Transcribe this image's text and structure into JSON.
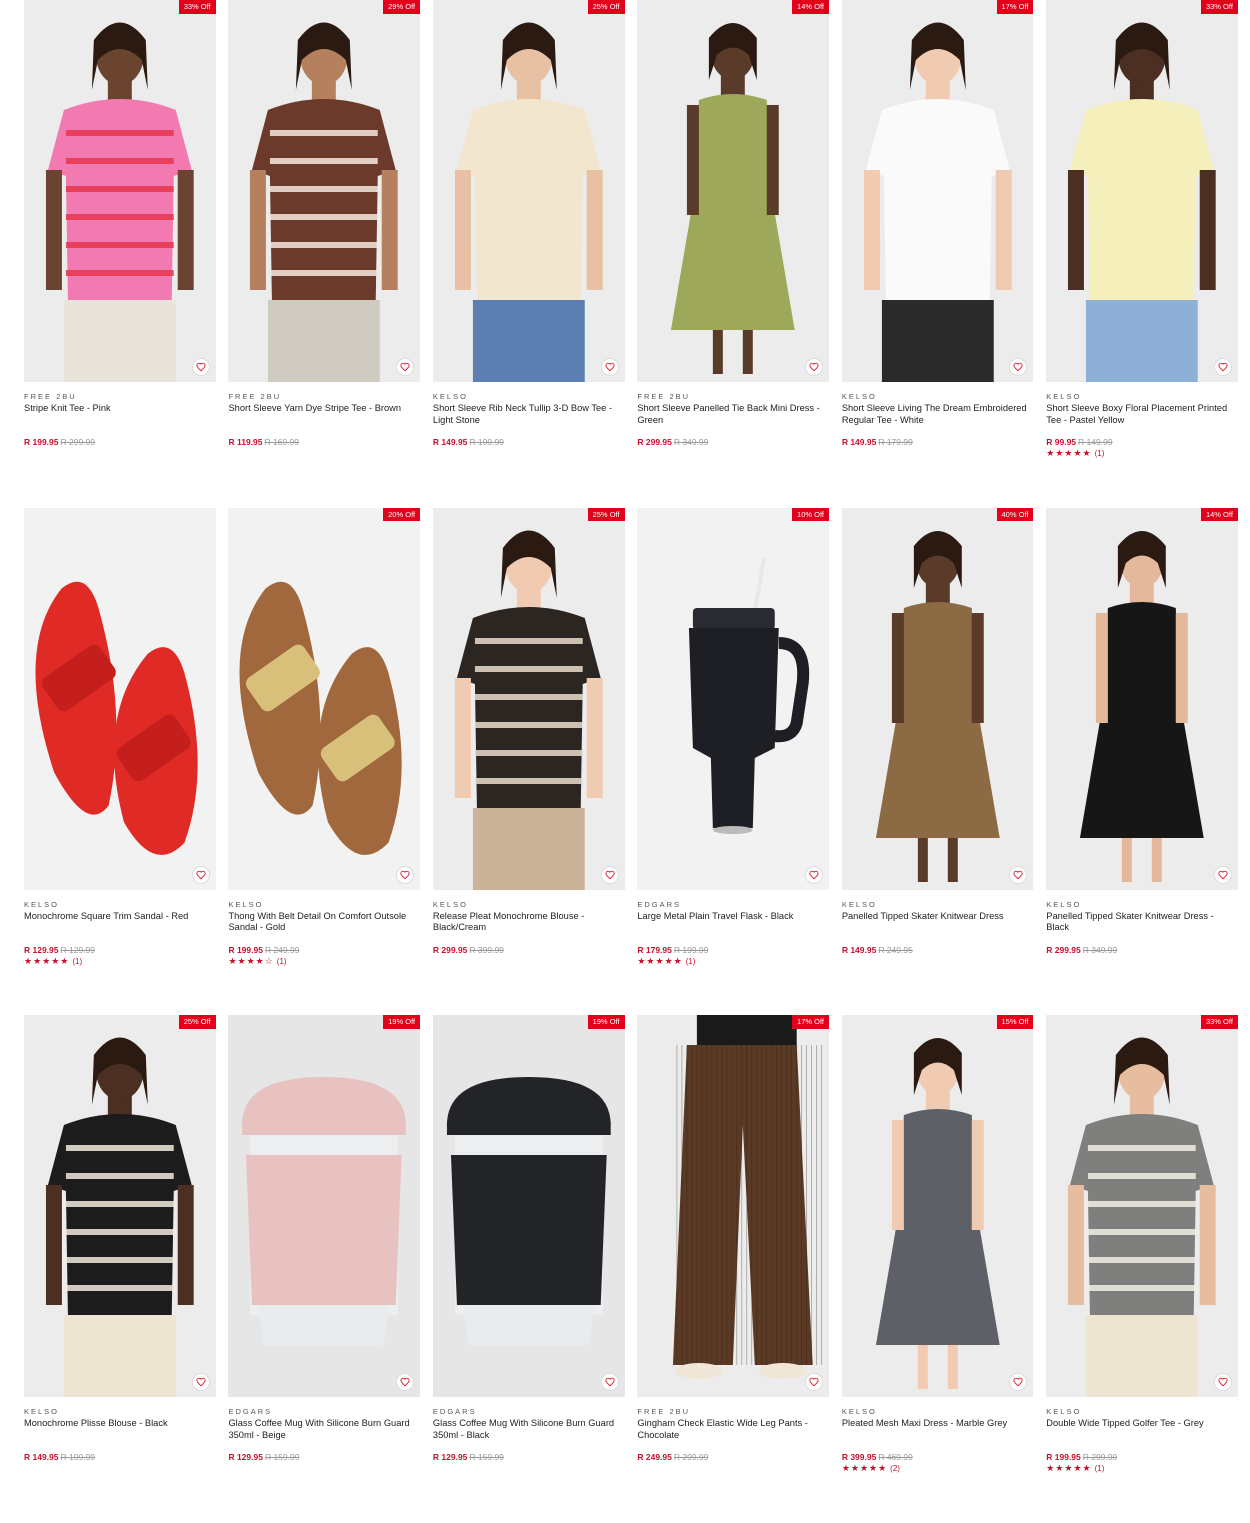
{
  "products": [
    {
      "brand": "FREE 2BU",
      "name": "Stripe Knit Tee - Pink",
      "price": "R 199.95",
      "was": "R 299.99",
      "discount": "33% Off",
      "rating": null,
      "count": null,
      "art": "model",
      "garment": "#f27ab0",
      "stripe": "#e8344d",
      "skin": "#6b4430",
      "bottom": "#e8e4dc"
    },
    {
      "brand": "FREE 2BU",
      "name": "Short Sleeve Yarn Dye Stripe Tee - Brown",
      "price": "R 119.95",
      "was": "R 169.99",
      "discount": "29% Off",
      "rating": null,
      "count": null,
      "art": "model",
      "garment": "#6b3a2a",
      "stripe": "#f3e9dc",
      "skin": "#b5805e",
      "bottom": "#cfcbc0"
    },
    {
      "brand": "KELSO",
      "name": "Short Sleeve Rib Neck Tullip 3-D Bow Tee - Light Stone",
      "price": "R 149.95",
      "was": "R 199.99",
      "discount": "25% Off",
      "rating": null,
      "count": null,
      "art": "model",
      "garment": "#f3e6cf",
      "stripe": null,
      "skin": "#e8c1a4",
      "bottom": "#5b7fb3"
    },
    {
      "brand": "FREE 2BU",
      "name": "Short Sleeve Panelled Tie Back Mini Dress - Green",
      "price": "R 299.95",
      "was": "R 349.99",
      "discount": "14% Off",
      "rating": null,
      "count": null,
      "art": "dress",
      "garment": "#9ea85a",
      "stripe": null,
      "skin": "#5a3a28",
      "bottom": "#9ea85a"
    },
    {
      "brand": "KELSO",
      "name": "Short Sleeve Living The Dream Embroidered Regular Tee - White",
      "price": "R 149.95",
      "was": "R 179.99",
      "discount": "17% Off",
      "rating": null,
      "count": null,
      "art": "model",
      "garment": "#fafafa",
      "stripe": null,
      "skin": "#f0cbb2",
      "bottom": "#2a2a2a"
    },
    {
      "brand": "KELSO",
      "name": "Short Sleeve Boxy Floral Placement Printed Tee - Pastel Yellow",
      "price": "R 99.95",
      "was": "R 149.99",
      "discount": "33% Off",
      "rating": 5,
      "count": "(1)",
      "art": "model",
      "garment": "#f5efbb",
      "stripe": null,
      "skin": "#4a2f22",
      "bottom": "#8fb0d6"
    },
    {
      "brand": "KELSO",
      "name": "Monochrome Square Trim Sandal - Red",
      "price": "R 129.95",
      "was": "R 129.99",
      "discount": null,
      "rating": 5,
      "count": "(1)",
      "art": "sandal",
      "garment": "#e02a26",
      "stripe": null,
      "skin": null,
      "bottom": null
    },
    {
      "brand": "KELSO",
      "name": "Thong With Belt Detail On Comfort Outsole Sandal - Gold",
      "price": "R 199.95",
      "was": "R 249.99",
      "discount": "20% Off",
      "rating": 4,
      "count": "(1)",
      "art": "sandal",
      "garment": "#c79a5b",
      "stripe": null,
      "skin": null,
      "bottom": null
    },
    {
      "brand": "KELSO",
      "name": "Release Pleat Monochrome Blouse - Black/Cream",
      "price": "R 299.95",
      "was": "R 399.99",
      "discount": "25% Off",
      "rating": null,
      "count": null,
      "art": "model",
      "garment": "#2b2622",
      "stripe": "#e8dccb",
      "skin": "#f0cbb2",
      "bottom": "#c9b49a"
    },
    {
      "brand": "EDGARS",
      "name": "Large Metal Plain Travel Flask - Black",
      "price": "R 179.95",
      "was": "R 199.99",
      "discount": "10% Off",
      "rating": 5,
      "count": "(1)",
      "art": "flask",
      "garment": "#1e1f24",
      "stripe": null,
      "skin": null,
      "bottom": null
    },
    {
      "brand": "KELSO",
      "name": "Panelled Tipped Skater Knitwear Dress",
      "price": "R 149.95",
      "was": "R 249.95",
      "discount": "40% Off",
      "rating": null,
      "count": null,
      "art": "dress",
      "garment": "#8c6a44",
      "stripe": null,
      "skin": "#5a3a28",
      "bottom": "#8c6a44"
    },
    {
      "brand": "KELSO",
      "name": "Panelled Tipped Skater Knitwear Dress - Black",
      "price": "R 299.95",
      "was": "R 349.99",
      "discount": "14% Off",
      "rating": null,
      "count": null,
      "art": "dress",
      "garment": "#161616",
      "stripe": null,
      "skin": "#e4b89a",
      "bottom": "#161616"
    },
    {
      "brand": "KELSO",
      "name": "Monochrome Plisse Blouse - Black",
      "price": "R 149.95",
      "was": "R 199.99",
      "discount": "25% Off",
      "rating": null,
      "count": null,
      "art": "model",
      "garment": "#1c1c1c",
      "stripe": "#f0e9dc",
      "skin": "#4a2f22",
      "bottom": "#ede4d2"
    },
    {
      "brand": "EDGARS",
      "name": "Glass Coffee Mug With Silicone Burn Guard 350ml - Beige",
      "price": "R 129.95",
      "was": "R 159.99",
      "discount": "19% Off",
      "rating": null,
      "count": null,
      "art": "mug",
      "garment": "#e8c2c0",
      "stripe": null,
      "skin": null,
      "bottom": null
    },
    {
      "brand": "EDGARS",
      "name": "Glass Coffee Mug With Silicone Burn Guard 350ml - Black",
      "price": "R 129.95",
      "was": "R 159.99",
      "discount": "19% Off",
      "rating": null,
      "count": null,
      "art": "mug",
      "garment": "#232427",
      "stripe": null,
      "skin": null,
      "bottom": null
    },
    {
      "brand": "FREE 2BU",
      "name": "Gingham Check Elastic Wide Leg Pants - Chocolate",
      "price": "R 249.95",
      "was": "R 299.99",
      "discount": "17% Off",
      "rating": null,
      "count": null,
      "art": "pants",
      "garment": "#5a3a24",
      "stripe": null,
      "skin": null,
      "bottom": "#5a3a24"
    },
    {
      "brand": "KELSO",
      "name": "Pleated Mesh Maxi Dress - Marble Grey",
      "price": "R 399.95",
      "was": "R 469.99",
      "discount": "15% Off",
      "rating": 5,
      "count": "(2)",
      "art": "dress",
      "garment": "#5e6068",
      "stripe": null,
      "skin": "#f0cbb2",
      "bottom": "#5e6068"
    },
    {
      "brand": "KELSO",
      "name": "Double Wide Tipped Golfer Tee - Grey",
      "price": "R 199.95",
      "was": "R 299.99",
      "discount": "33% Off",
      "rating": 5,
      "count": "(1)",
      "art": "model",
      "garment": "#7f7f7d",
      "stripe": "#f2eee4",
      "skin": "#e6bd9e",
      "bottom": "#ede4d2"
    }
  ],
  "icons": {
    "wishlist": "heart-icon",
    "rating": "star-icon"
  },
  "colors": {
    "accent": "#e2001a",
    "price": "#c8102e",
    "was": "#999999"
  }
}
